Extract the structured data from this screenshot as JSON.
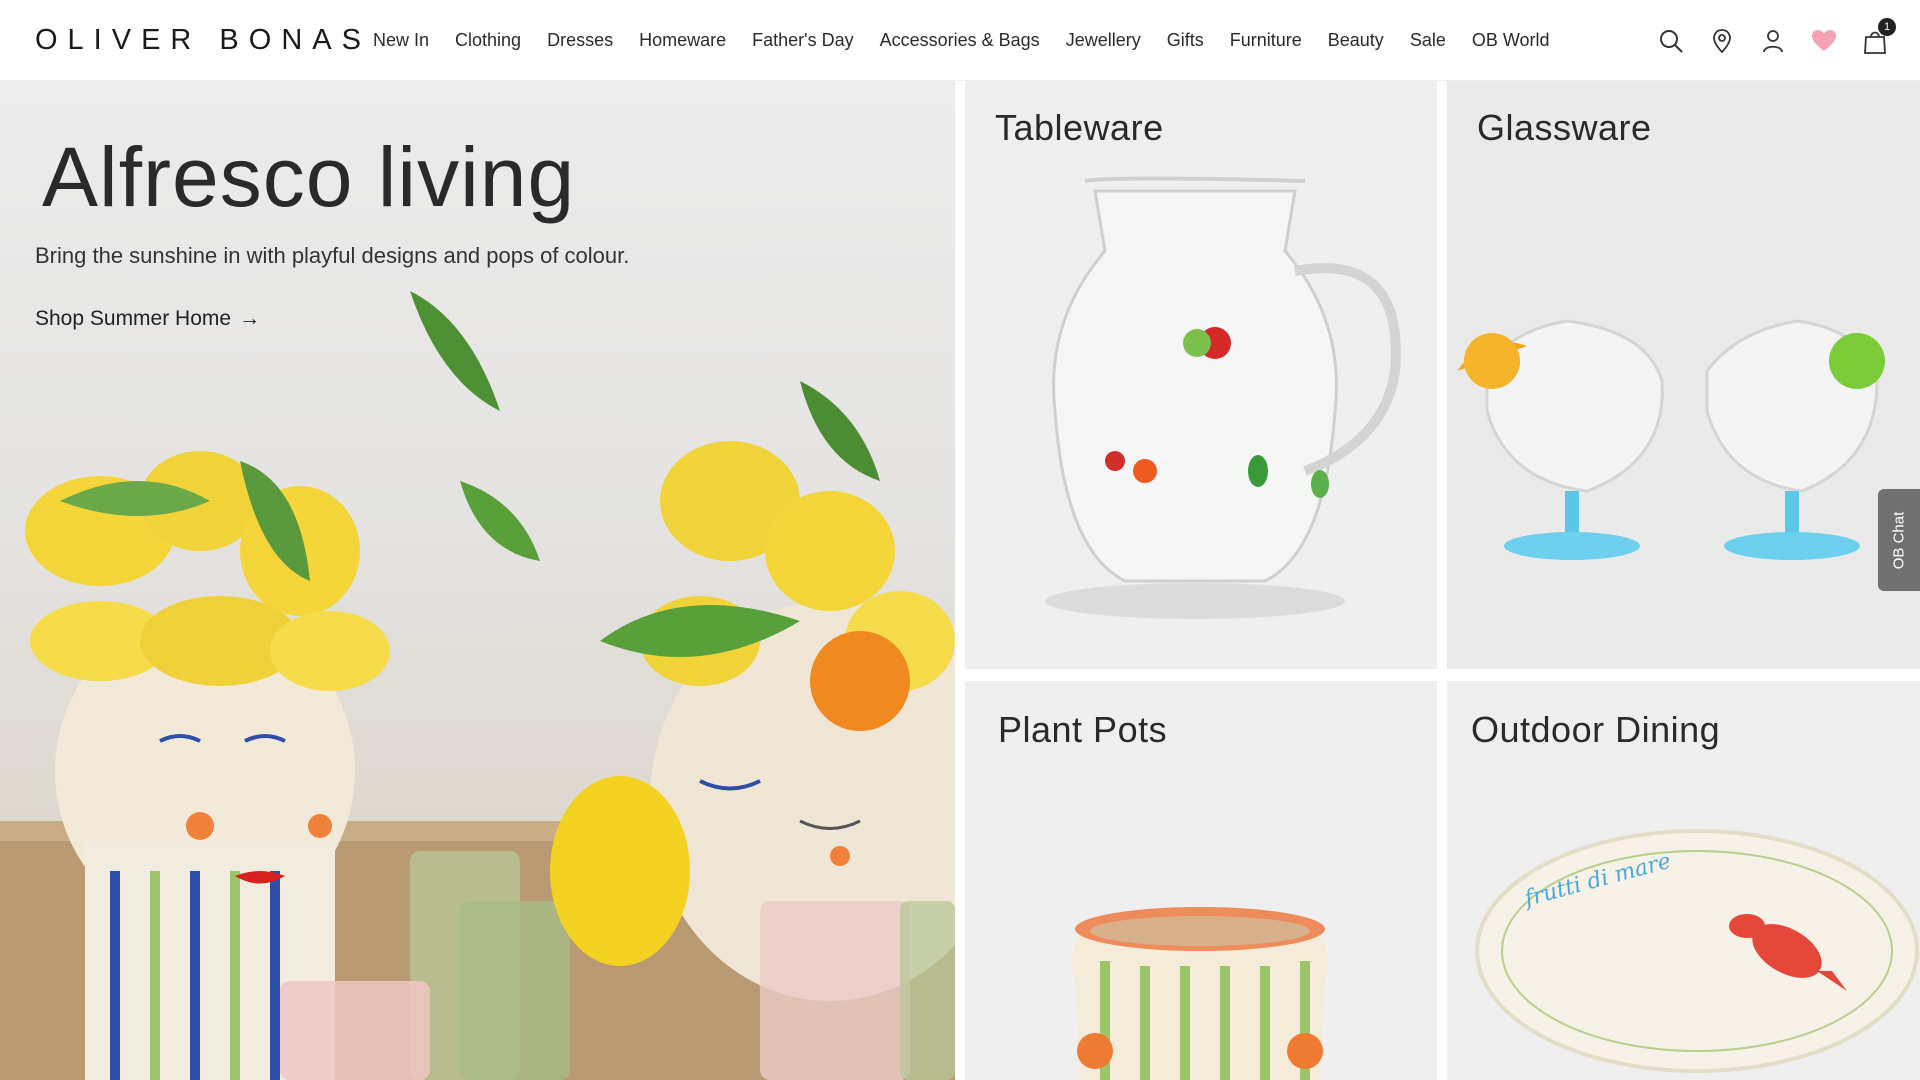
{
  "brand": {
    "logo": "OLIVER BONAS"
  },
  "nav": [
    {
      "label": "New In"
    },
    {
      "label": "Clothing"
    },
    {
      "label": "Dresses"
    },
    {
      "label": "Homeware"
    },
    {
      "label": "Father's Day"
    },
    {
      "label": "Accessories & Bags"
    },
    {
      "label": "Jewellery"
    },
    {
      "label": "Gifts"
    },
    {
      "label": "Furniture"
    },
    {
      "label": "Beauty"
    },
    {
      "label": "Sale"
    },
    {
      "label": "OB World"
    }
  ],
  "header_icons": {
    "icons": [
      "search-icon",
      "location-pin-icon",
      "account-icon",
      "heart-icon",
      "bag-icon"
    ],
    "bag_count": "1",
    "heart_color": "#f4a3b4"
  },
  "hero": {
    "title": "Alfresco living",
    "subtitle": "Bring the sunshine in with playful designs and pops of colour.",
    "cta": "Shop Summer Home",
    "cta_arrow": "→"
  },
  "categories": [
    {
      "title": "Tableware"
    },
    {
      "title": "Glassware"
    },
    {
      "title": "Plant Pots"
    },
    {
      "title": "Outdoor Dining"
    }
  ],
  "platter_script": "frutti di mare",
  "chat": {
    "label": "OB Chat"
  }
}
